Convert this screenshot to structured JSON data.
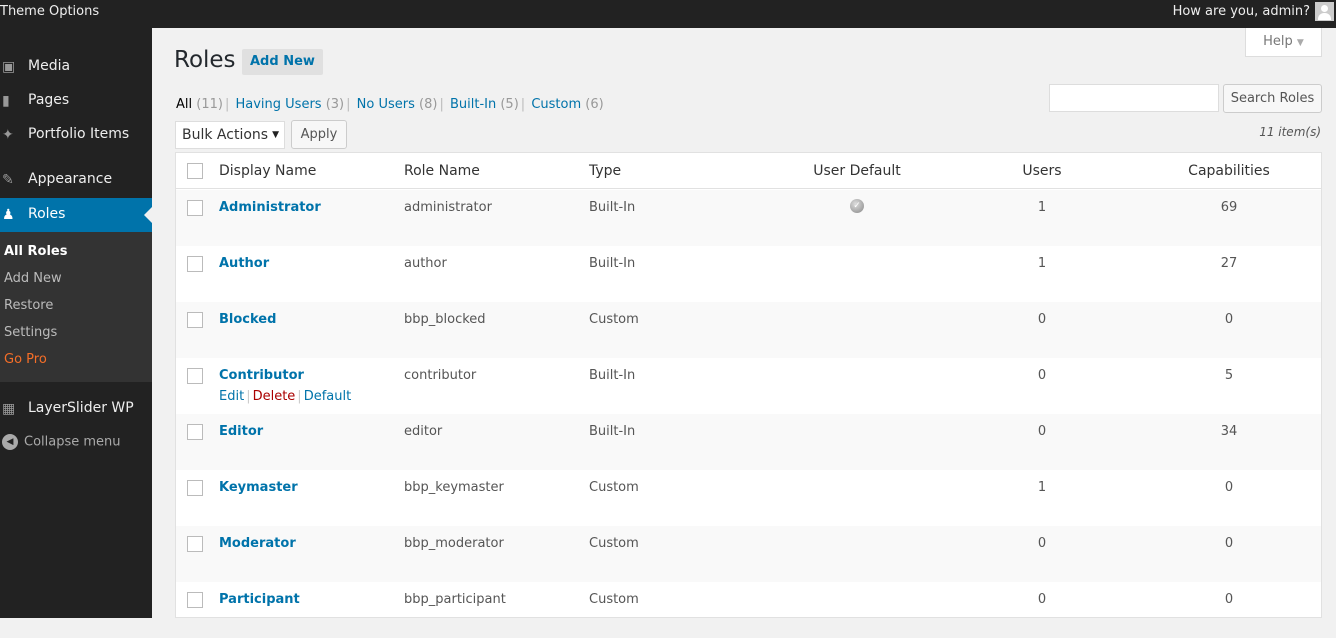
{
  "topbar": {
    "site_name": "Theme Options",
    "greeting": "How are you, admin?"
  },
  "sidebar": {
    "items": [
      {
        "label": "Media",
        "icon": "media-icon"
      },
      {
        "label": "Pages",
        "icon": "pages-icon"
      },
      {
        "label": "Portfolio Items",
        "icon": "pin-icon"
      },
      {
        "label": "Appearance",
        "icon": "paintbrush-icon"
      },
      {
        "label": "Roles",
        "icon": "users-icon"
      },
      {
        "label": "LayerSlider WP",
        "icon": "images-icon"
      }
    ],
    "submenu": [
      "All Roles",
      "Add New",
      "Restore",
      "Settings",
      "Go Pro"
    ],
    "collapse": "Collapse menu"
  },
  "header": {
    "title": "Roles",
    "add_new": "Add New",
    "help": "Help"
  },
  "views": [
    {
      "label": "All",
      "count": "(11)"
    },
    {
      "label": "Having Users",
      "count": "(3)"
    },
    {
      "label": "No Users",
      "count": "(8)"
    },
    {
      "label": "Built-In",
      "count": "(5)"
    },
    {
      "label": "Custom",
      "count": "(6)"
    }
  ],
  "search": {
    "value": "",
    "button": "Search Roles"
  },
  "bulk": {
    "selected": "Bulk Actions",
    "apply": "Apply"
  },
  "items_count": "11 item(s)",
  "table": {
    "columns": [
      "Display Name",
      "Role Name",
      "Type",
      "User Default",
      "Users",
      "Capabilities"
    ],
    "row_actions": {
      "edit": "Edit",
      "delete": "Delete",
      "default": "Default"
    },
    "rows": [
      {
        "display": "Administrator",
        "role": "administrator",
        "type": "Built-In",
        "default": true,
        "users": "1",
        "caps": "69"
      },
      {
        "display": "Author",
        "role": "author",
        "type": "Built-In",
        "default": false,
        "users": "1",
        "caps": "27"
      },
      {
        "display": "Blocked",
        "role": "bbp_blocked",
        "type": "Custom",
        "default": false,
        "users": "0",
        "caps": "0"
      },
      {
        "display": "Contributor",
        "role": "contributor",
        "type": "Built-In",
        "default": false,
        "users": "0",
        "caps": "5"
      },
      {
        "display": "Editor",
        "role": "editor",
        "type": "Built-In",
        "default": false,
        "users": "0",
        "caps": "34"
      },
      {
        "display": "Keymaster",
        "role": "bbp_keymaster",
        "type": "Custom",
        "default": false,
        "users": "1",
        "caps": "0"
      },
      {
        "display": "Moderator",
        "role": "bbp_moderator",
        "type": "Custom",
        "default": false,
        "users": "0",
        "caps": "0"
      },
      {
        "display": "Participant",
        "role": "bbp_participant",
        "type": "Custom",
        "default": false,
        "users": "0",
        "caps": "0"
      }
    ]
  }
}
